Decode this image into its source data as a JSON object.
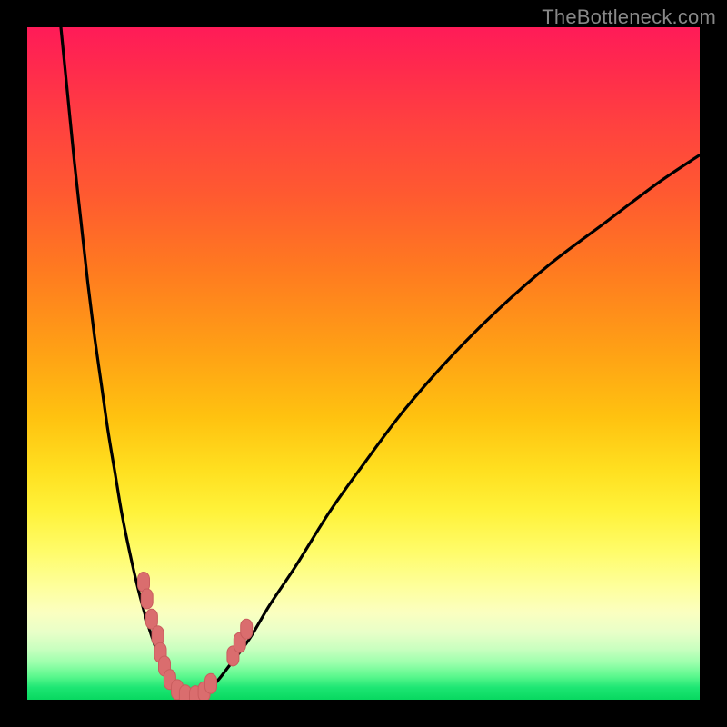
{
  "watermark": "TheBottleneck.com",
  "colors": {
    "frame": "#000000",
    "curve": "#000000",
    "marker_fill": "#da6d6e",
    "marker_stroke": "#c95d5e",
    "gradient_top": "#ff1b58",
    "gradient_bottom": "#08d860"
  },
  "chart_data": {
    "type": "line",
    "title": "",
    "xlabel": "",
    "ylabel": "",
    "xlim": [
      0,
      100
    ],
    "ylim": [
      0,
      100
    ],
    "grid": false,
    "legend": false,
    "series": [
      {
        "name": "bottleneck-curve",
        "x": [
          5,
          6,
          7,
          8,
          9,
          10,
          11,
          12,
          13,
          14,
          15,
          16,
          17,
          18,
          19,
          20,
          21,
          22,
          23,
          24,
          26,
          28,
          30,
          33,
          36,
          40,
          45,
          50,
          56,
          63,
          70,
          78,
          86,
          94,
          100
        ],
        "y": [
          100,
          90,
          80,
          71,
          62,
          54,
          47,
          40,
          34,
          28,
          23,
          18.5,
          14.5,
          11,
          8,
          5.5,
          3.5,
          2,
          1,
          0.5,
          1,
          2.5,
          5,
          9,
          14,
          20,
          28,
          35,
          43,
          51,
          58,
          65,
          71,
          77,
          81
        ]
      }
    ],
    "markers": {
      "name": "sample-points",
      "shape": "rounded-rect",
      "points": [
        {
          "x": 17.3,
          "y": 17.5
        },
        {
          "x": 17.8,
          "y": 15
        },
        {
          "x": 18.5,
          "y": 12
        },
        {
          "x": 19.4,
          "y": 9.5
        },
        {
          "x": 19.8,
          "y": 7
        },
        {
          "x": 20.4,
          "y": 5
        },
        {
          "x": 21.2,
          "y": 3
        },
        {
          "x": 22.3,
          "y": 1.5
        },
        {
          "x": 23.5,
          "y": 0.7
        },
        {
          "x": 25,
          "y": 0.6
        },
        {
          "x": 26.3,
          "y": 1.2
        },
        {
          "x": 27.3,
          "y": 2.4
        },
        {
          "x": 30.6,
          "y": 6.5
        },
        {
          "x": 31.6,
          "y": 8.5
        },
        {
          "x": 32.6,
          "y": 10.5
        }
      ]
    }
  }
}
